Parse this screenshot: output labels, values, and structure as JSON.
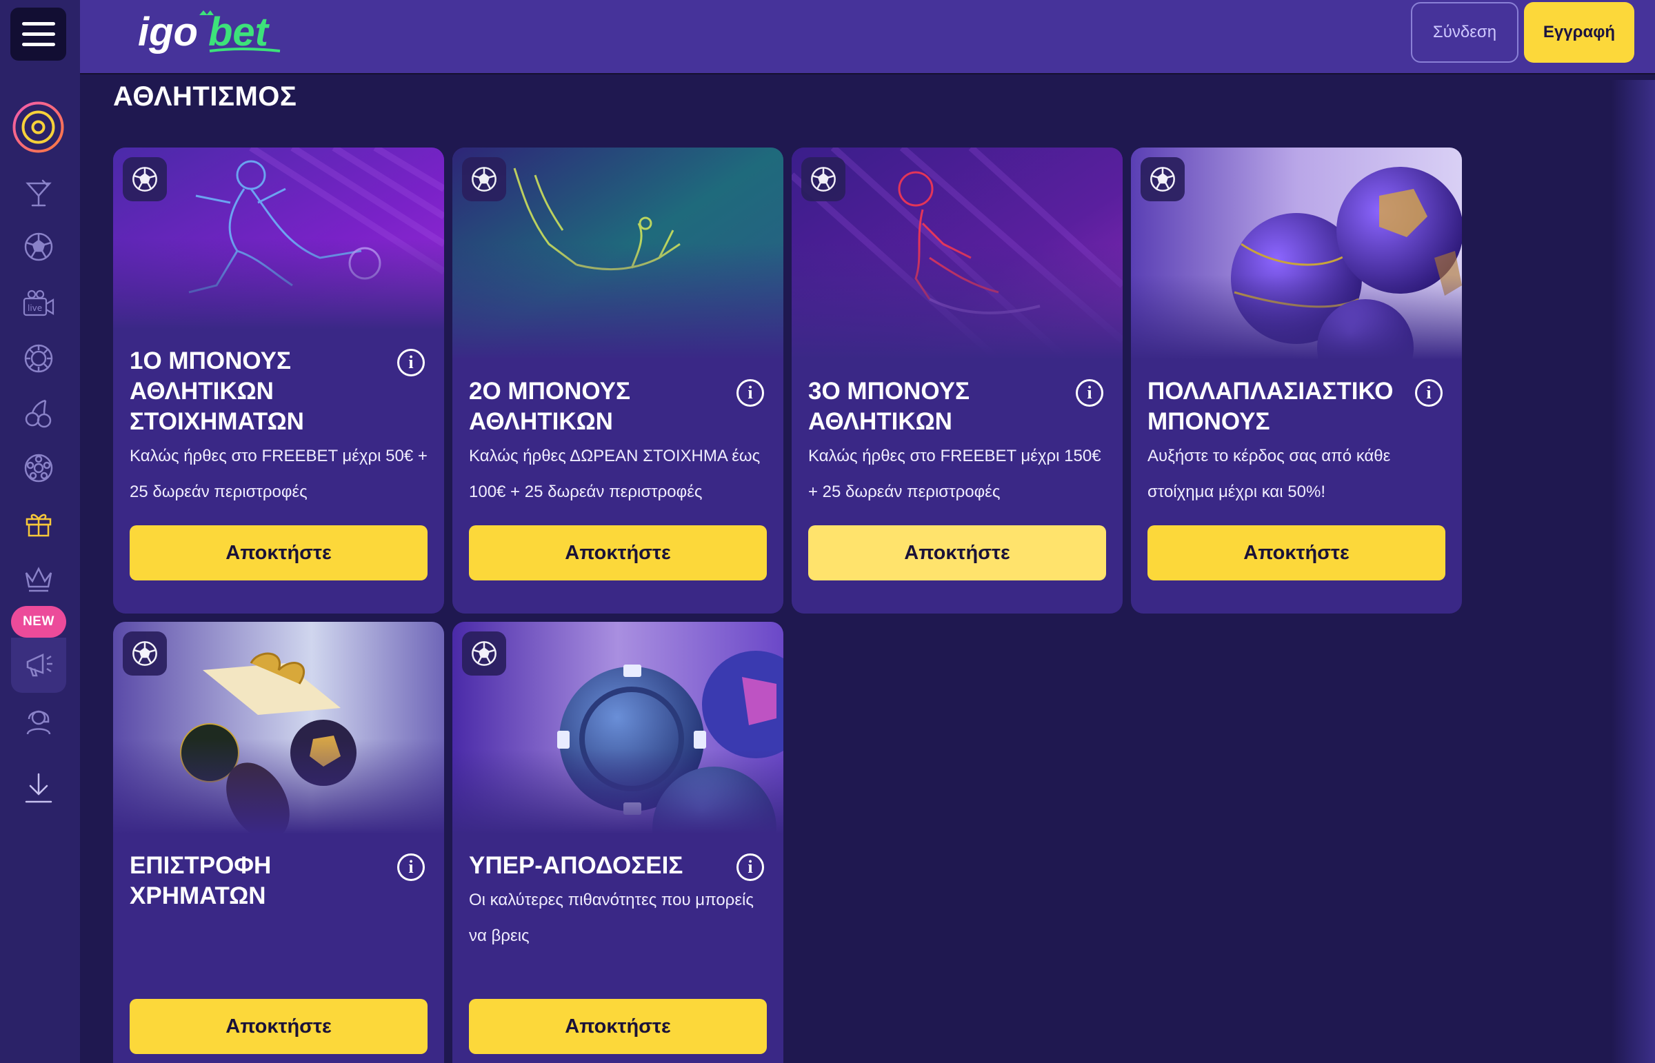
{
  "header": {
    "logo_text": "igobet",
    "login_label": "Σύνδεση",
    "register_label": "Εγγραφή"
  },
  "sidebar": {
    "items": [
      {
        "icon": "casino-target-icon"
      },
      {
        "icon": "cocktail-icon"
      },
      {
        "icon": "football-icon"
      },
      {
        "icon": "live-camera-icon"
      },
      {
        "icon": "casino-chip-icon"
      },
      {
        "icon": "cherries-icon"
      },
      {
        "icon": "roulette-icon"
      },
      {
        "icon": "gift-icon"
      },
      {
        "icon": "crown-icon"
      },
      {
        "icon": "megaphone-icon",
        "badge": "NEW"
      },
      {
        "icon": "support-agent-icon"
      },
      {
        "icon": "download-icon"
      }
    ],
    "new_badge": "NEW"
  },
  "main": {
    "title": "ΑΘΛΗΤΙΣΜΟΣ",
    "cards": [
      {
        "title": "1Ο ΜΠΟΝΟΥΣ ΑΘΛΗΤΙΚΩΝ ΣΤΟΙΧΗΜΑΤΩΝ",
        "description": "Καλώς ήρθες στο FREEBET μέχρι 50€ + 25 δωρεάν περιστροφές",
        "button": "Αποκτήστε"
      },
      {
        "title": "2Ο ΜΠΟΝΟΥΣ ΑΘΛΗΤΙΚΩΝ",
        "description": "Καλώς ήρθες ΔΩΡΕΑΝ ΣΤΟΙΧΗΜΑ έως 100€ + 25 δωρεάν περιστροφές",
        "button": "Αποκτήστε"
      },
      {
        "title": "3Ο ΜΠΟΝΟΥΣ ΑΘΛΗΤΙΚΩΝ",
        "description": "Καλώς ήρθες στο FREEBET μέχρι 150€ + 25 δωρεάν περιστροφές",
        "button": "Αποκτήστε"
      },
      {
        "title": "ΠΟΛΛΑΠΛΑΣΙΑΣΤΙΚΟ ΜΠΟΝΟΥΣ",
        "description": "Αυξήστε το κέρδος σας από κάθε στοίχημα μέχρι και 50%!",
        "button": "Αποκτήστε"
      },
      {
        "title": "ΕΠΙΣΤΡΟΦΗ ΧΡΗΜΑΤΩΝ",
        "description": "",
        "button": "Αποκτήστε"
      },
      {
        "title": "ΥΠΕΡ-ΑΠΟΔΟΣΕΙΣ",
        "description": "Οι καλύτερες πιθανότητες που μπορείς να βρεις",
        "button": "Αποκτήστε"
      }
    ]
  },
  "colors": {
    "background": "#1f1850",
    "sidebar": "#2b2268",
    "header": "#46339a",
    "card": "#3a2886",
    "accent_yellow": "#fcd83a",
    "logo_green": "#3de27a",
    "new_badge": "#ec4b9a"
  }
}
